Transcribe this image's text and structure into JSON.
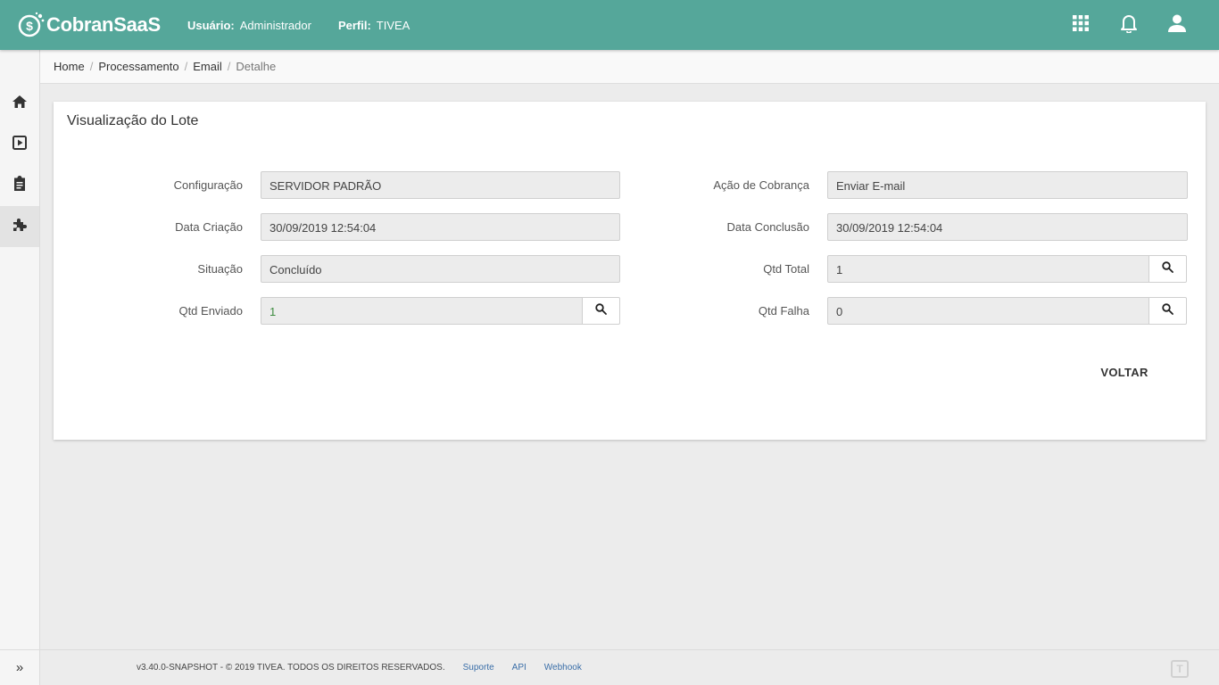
{
  "app": {
    "name": "CobranSaaS"
  },
  "header": {
    "user_label": "Usuário:",
    "user_value": "Administrador",
    "profile_label": "Perfil:",
    "profile_value": "TIVEA",
    "icons": [
      "apps-grid-icon",
      "bell-icon",
      "user-icon"
    ]
  },
  "sidebar": {
    "items": [
      {
        "icon": "home-icon"
      },
      {
        "icon": "play-icon"
      },
      {
        "icon": "clipboard-icon"
      },
      {
        "icon": "puzzle-icon",
        "active": true
      }
    ],
    "toggle": "»"
  },
  "breadcrumb": {
    "items": [
      "Home",
      "Processamento",
      "Email"
    ],
    "current": "Detalhe"
  },
  "card": {
    "title": "Visualização do Lote",
    "left_fields": [
      {
        "label": "Configuração",
        "value": "SERVIDOR PADRÃO"
      },
      {
        "label": "Data Criação",
        "value": "30/09/2019 12:54:04"
      },
      {
        "label": "Situação",
        "value": "Concluído"
      },
      {
        "label": "Qtd Enviado",
        "value": "1"
      }
    ],
    "right_fields": [
      {
        "label": "Ação de Cobrança",
        "value": "Enviar E-mail"
      },
      {
        "label": "Data Conclusão",
        "value": "30/09/2019 12:54:04"
      },
      {
        "label": "Qtd Total",
        "value": "1"
      },
      {
        "label": "Qtd Falha",
        "value": "0"
      }
    ],
    "back_button": "VOLTAR"
  },
  "footer": {
    "version": "v3.40.0-SNAPSHOT - © 2019 TIVEA. TODOS OS DIREITOS RESERVADOS.",
    "links": [
      "Suporte",
      "API",
      "Webhook"
    ],
    "logo": "T"
  },
  "colors": {
    "primary": "#55a79a",
    "link": "#3a6ea8",
    "success_text": "#3d8c40"
  }
}
